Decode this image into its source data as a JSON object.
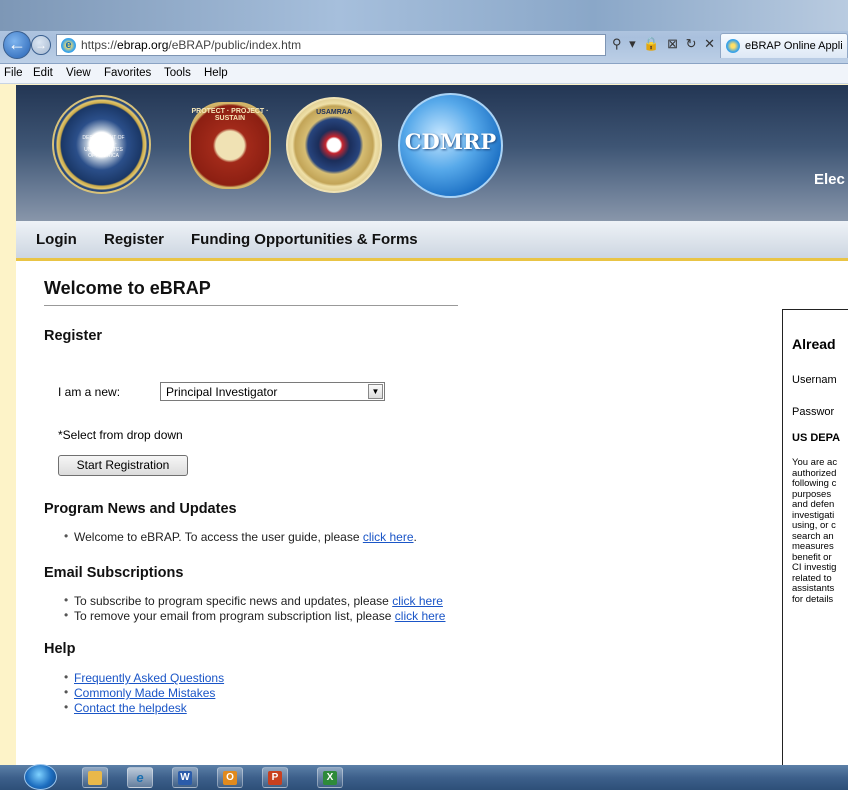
{
  "browser": {
    "url_prefix": "https://",
    "url_domain": "ebrap.org",
    "url_path": "/eBRAP/public/index.htm",
    "tab_title": "eBRAP Online Appli",
    "address_tools": "⚲ ▾ 🔒 ⊠ ↻ ✕",
    "menu": [
      "File",
      "Edit",
      "View",
      "Favorites",
      "Tools",
      "Help"
    ]
  },
  "banner": {
    "seals": [
      "DEPARTMENT OF DEFENSE · UNITED STATES OF AMERICA",
      "PROTECT · PROJECT · SUSTAIN",
      "USAMRAA",
      "CDMRP"
    ],
    "site_title_partial": "Elec"
  },
  "nav": {
    "items": [
      "Login",
      "Register",
      "Funding Opportunities & Forms"
    ]
  },
  "main": {
    "title": "Welcome to eBRAP",
    "register": {
      "heading": "Register",
      "label": "I am a new:",
      "selected_role": "Principal Investigator",
      "note": "*Select from drop down",
      "button": "Start Registration"
    },
    "news": {
      "heading": "Program News and Updates",
      "items": [
        {
          "text": "Welcome to eBRAP. To access the user guide, please ",
          "link": "click here",
          "after": "."
        }
      ]
    },
    "email": {
      "heading": "Email Subscriptions",
      "items": [
        {
          "text": "To subscribe to program specific news and updates, please ",
          "link": "click here"
        },
        {
          "text": "To remove your email from program subscription list, please ",
          "link": "click here"
        }
      ]
    },
    "help": {
      "heading": "Help",
      "links": [
        "Frequently Asked Questions",
        "Commonly Made Mistakes",
        "Contact the helpdesk"
      ]
    }
  },
  "login_panel": {
    "title": "Alread",
    "username_label": "Usernam",
    "password_label": "Passwor",
    "department": "US DEPA",
    "warning": "You are ac\nauthorized\nfollowing c\npurposes\nand defen\ninvestigati\nusing, or c\nsearch an\nmeasures\nbenefit or\nCI investig\nrelated to\nassistants\nfor details"
  },
  "taskbar": {
    "apps": [
      "file-explorer",
      "internet-explorer",
      "word",
      "outlook",
      "powerpoint",
      "excel"
    ],
    "app_letters": [
      "",
      "e",
      "W",
      "O",
      "P",
      "X"
    ]
  }
}
